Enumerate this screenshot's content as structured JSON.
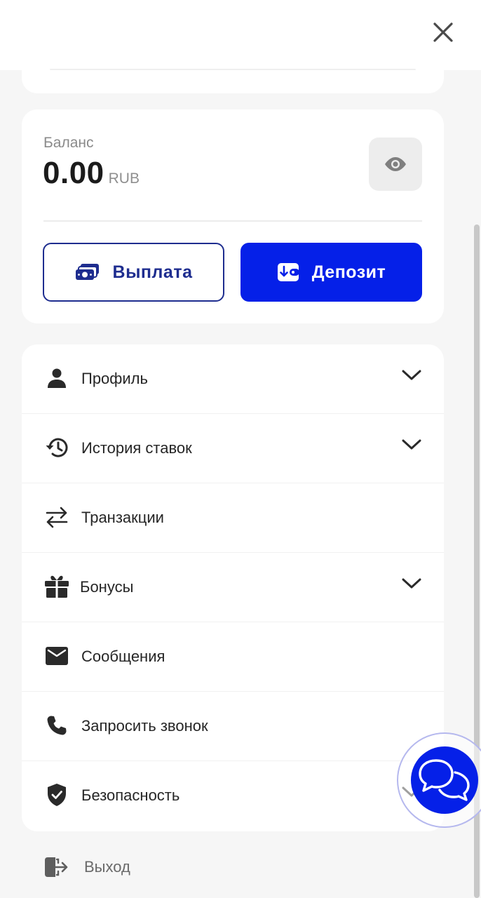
{
  "balance": {
    "label": "Баланс",
    "amount": "0.00",
    "currency": "RUB"
  },
  "actions": {
    "withdraw_label": "Выплата",
    "deposit_label": "Депозит"
  },
  "menu": {
    "items": [
      {
        "label": "Профиль",
        "icon": "user-icon",
        "expandable": true
      },
      {
        "label": "История ставок",
        "icon": "history-icon",
        "expandable": true
      },
      {
        "label": "Транзакции",
        "icon": "transfer-arrows-icon",
        "expandable": false
      },
      {
        "label": "Бонусы",
        "icon": "gift-icon",
        "expandable": true
      },
      {
        "label": "Сообщения",
        "icon": "mail-icon",
        "expandable": false
      },
      {
        "label": "Запросить звонок",
        "icon": "phone-icon",
        "expandable": false
      },
      {
        "label": "Безопасность",
        "icon": "shield-check-icon",
        "expandable": true
      }
    ]
  },
  "logout": {
    "label": "Выход",
    "icon": "logout-icon"
  },
  "colors": {
    "accent": "#0520E8",
    "outline_button": "#1E2D8F",
    "background": "#F6F6F6",
    "card": "#FFFFFF"
  }
}
